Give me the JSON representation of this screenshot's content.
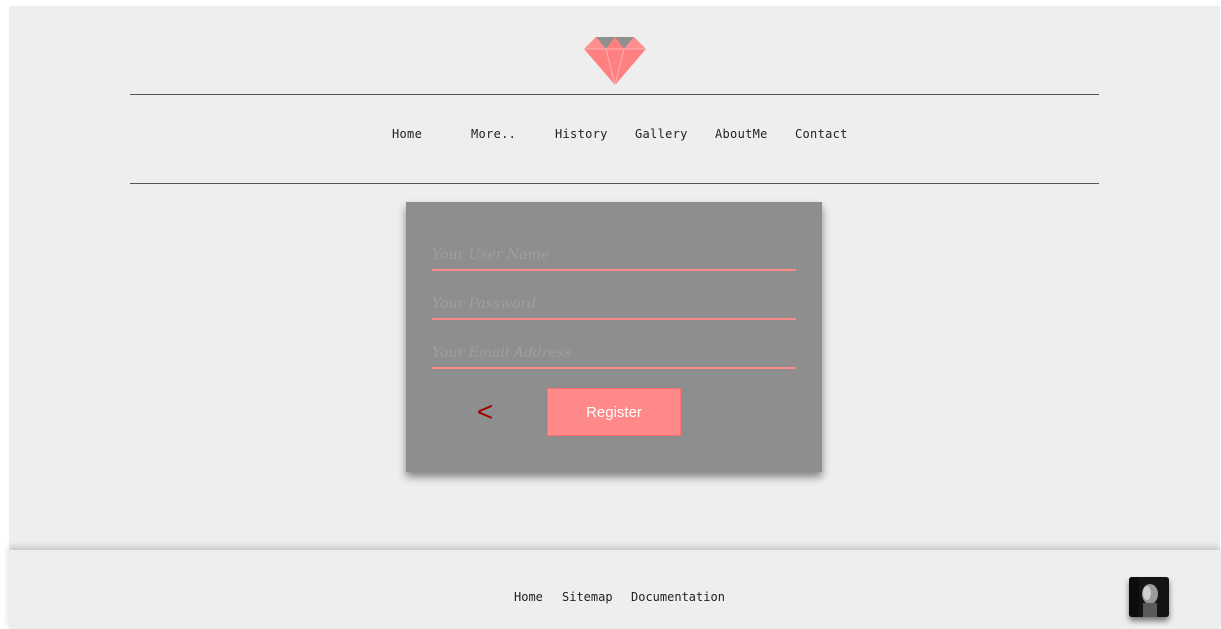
{
  "nav": {
    "items": [
      {
        "label": "Home"
      },
      {
        "label": "More.."
      },
      {
        "label": "History"
      },
      {
        "label": "Gallery"
      },
      {
        "label": "AboutMe"
      },
      {
        "label": "Contact"
      }
    ]
  },
  "form": {
    "username_placeholder": "Your User Name",
    "password_placeholder": "Your Password",
    "email_placeholder": "Your Email Address",
    "back_label": "<",
    "register_label": "Register"
  },
  "footer": {
    "links": [
      {
        "label": "Home"
      },
      {
        "label": "Sitemap"
      },
      {
        "label": "Documentation"
      }
    ]
  },
  "colors": {
    "accent": "#ff8888",
    "card": "#8e8e8e",
    "background": "#eeeeee",
    "back_arrow": "#a00000"
  },
  "icons": {
    "logo": "diamond-icon",
    "avatar": "user-avatar"
  }
}
